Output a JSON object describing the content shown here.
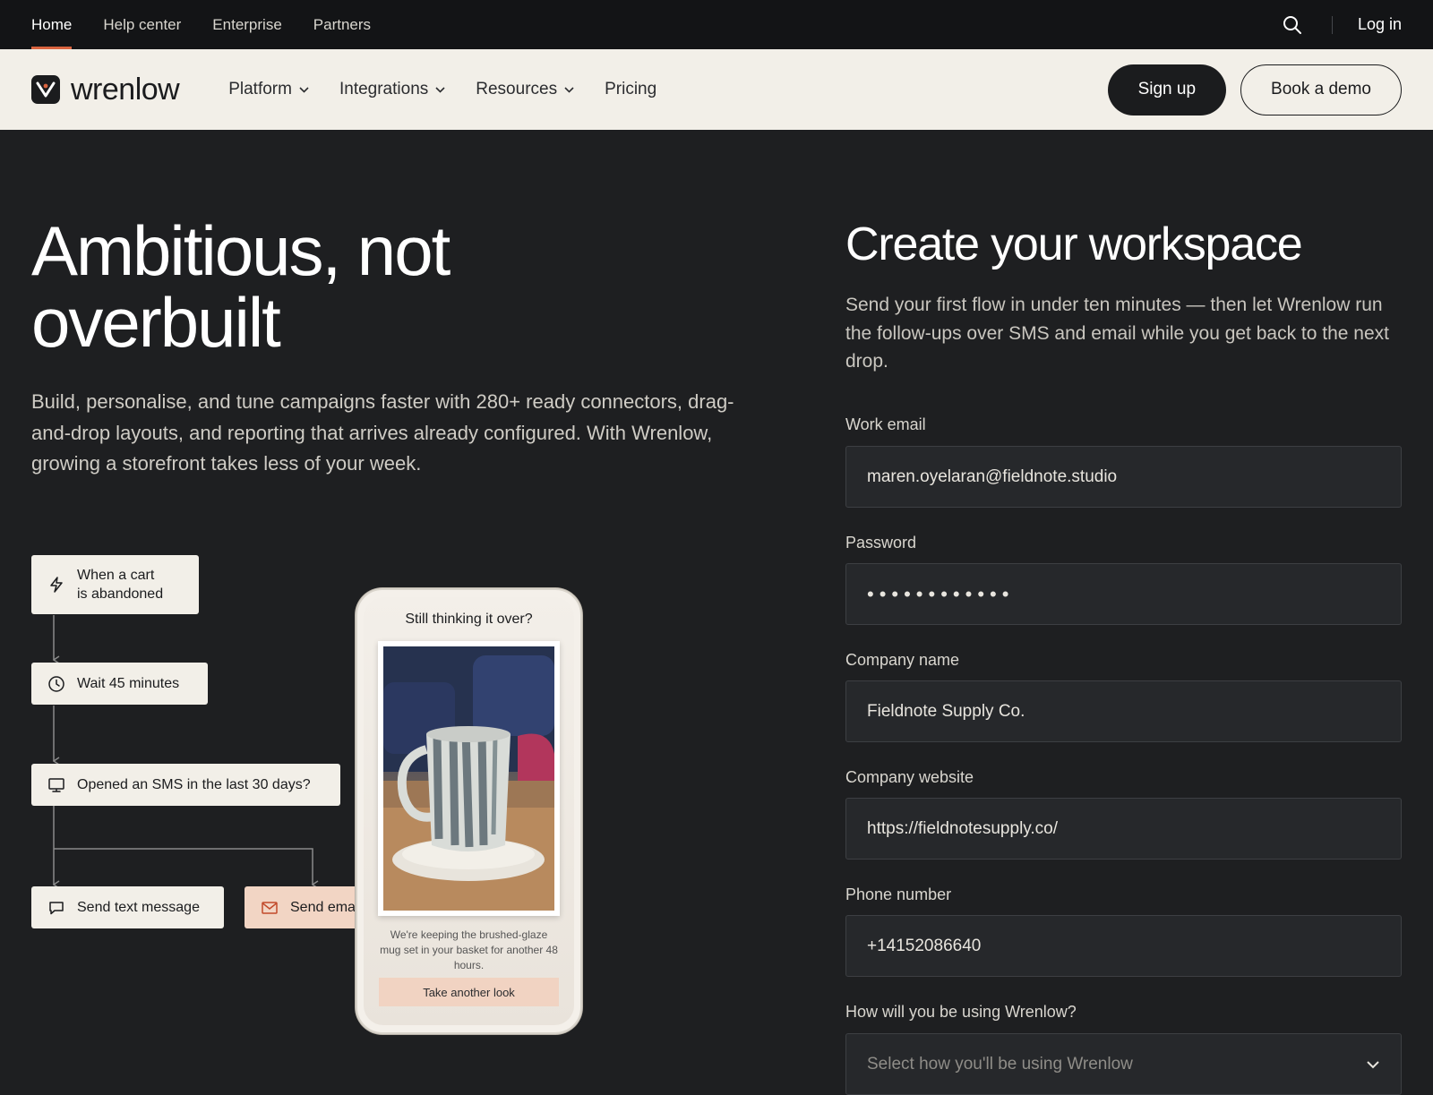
{
  "utility_bar": {
    "links": [
      {
        "label": "Home",
        "active": true
      },
      {
        "label": "Help center",
        "active": false
      },
      {
        "label": "Enterprise",
        "active": false
      },
      {
        "label": "Partners",
        "active": false
      }
    ],
    "search_icon": "search-icon",
    "login_label": "Log in"
  },
  "nav": {
    "brand_name": "wrenlow",
    "items": [
      {
        "label": "Platform",
        "has_dropdown": true
      },
      {
        "label": "Integrations",
        "has_dropdown": true
      },
      {
        "label": "Resources",
        "has_dropdown": true
      },
      {
        "label": "Pricing",
        "has_dropdown": false
      }
    ],
    "signup_label": "Sign up",
    "demo_label": "Book a demo"
  },
  "hero": {
    "title": "Ambitious, not overbuilt",
    "description": "Build, personalise, and tune campaigns faster with 280+ ready connectors, drag-and-drop layouts, and reporting that arrives already configured. With Wrenlow, growing a storefront takes less of your week."
  },
  "flow": {
    "trigger": {
      "line1": "When a cart",
      "line2": "is abandoned",
      "icon": "lightning-icon"
    },
    "wait": {
      "label": "Wait 45 minutes",
      "icon": "clock-icon"
    },
    "condition": {
      "label": "Opened an SMS in the last 30 days?",
      "icon": "monitor-icon"
    },
    "sms": {
      "label": "Send text message",
      "icon": "chat-bubble-icon"
    },
    "email": {
      "label": "Send email",
      "icon": "envelope-icon"
    }
  },
  "phone": {
    "heading": "Still thinking it over?",
    "caption": "We're keeping the brushed-glaze mug set in your basket for another 48 hours.",
    "cta_label": "Take another look"
  },
  "form": {
    "title": "Create your workspace",
    "description": "Send your first flow in under ten minutes — then let Wrenlow run the follow-ups over SMS and email while you get back to the next drop.",
    "fields": {
      "email": {
        "label": "Work email",
        "value": "maren.oyelaran@fieldnote.studio"
      },
      "password": {
        "label": "Password",
        "value": "••••••••••••"
      },
      "company": {
        "label": "Company name",
        "value": "Fieldnote Supply Co."
      },
      "website": {
        "label": "Company website",
        "value": "https://fieldnotesupply.co/"
      },
      "phone": {
        "label": "Phone number",
        "value": "+14152086640"
      },
      "usage": {
        "label": "How will you be using Wrenlow?",
        "placeholder": "Select how you'll be using Wrenlow"
      }
    }
  },
  "colors": {
    "accent": "#d9643f",
    "page_bg": "#1e1f21",
    "nav_bg": "#f2efe8",
    "email_node": "#f2d5c4"
  }
}
